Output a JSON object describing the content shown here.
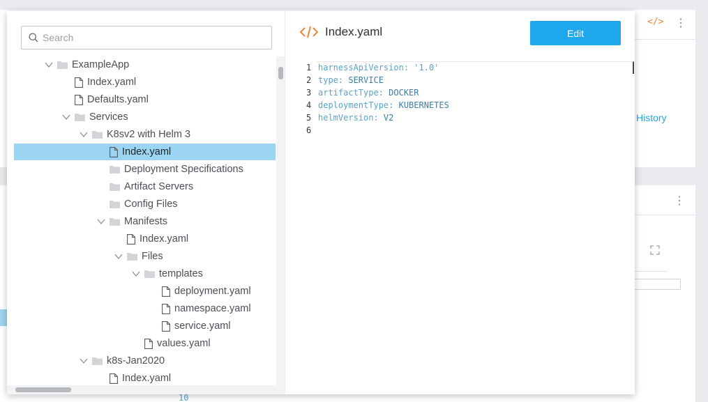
{
  "background": {
    "history_label": "History",
    "code_icon_label": "</>",
    "line_number": "10"
  },
  "search": {
    "placeholder": "Search"
  },
  "tree": [
    {
      "label": "ExampleApp",
      "type": "folder",
      "expanded": true,
      "depth": 0
    },
    {
      "label": "Index.yaml",
      "type": "file",
      "depth": 1
    },
    {
      "label": "Defaults.yaml",
      "type": "file",
      "depth": 1
    },
    {
      "label": "Services",
      "type": "folder",
      "expanded": true,
      "depth": 1
    },
    {
      "label": "K8sv2 with Helm 3",
      "type": "folder",
      "expanded": true,
      "depth": 2
    },
    {
      "label": "Index.yaml",
      "type": "file",
      "depth": 3,
      "selected": true
    },
    {
      "label": "Deployment Specifications",
      "type": "folder",
      "depth": 3
    },
    {
      "label": "Artifact Servers",
      "type": "folder",
      "depth": 3
    },
    {
      "label": "Config Files",
      "type": "folder",
      "depth": 3
    },
    {
      "label": "Manifests",
      "type": "folder",
      "expanded": true,
      "depth": 3
    },
    {
      "label": "Index.yaml",
      "type": "file",
      "depth": 4
    },
    {
      "label": "Files",
      "type": "folder",
      "expanded": true,
      "depth": 4
    },
    {
      "label": "templates",
      "type": "folder",
      "expanded": true,
      "depth": 5
    },
    {
      "label": "deployment.yaml",
      "type": "file",
      "depth": 6
    },
    {
      "label": "namespace.yaml",
      "type": "file",
      "depth": 6
    },
    {
      "label": "service.yaml",
      "type": "file",
      "depth": 6
    },
    {
      "label": "values.yaml",
      "type": "file",
      "depth": 5
    },
    {
      "label": "k8s-Jan2020",
      "type": "folder",
      "expanded": true,
      "depth": 2
    },
    {
      "label": "Index.yaml",
      "type": "file",
      "depth": 3
    }
  ],
  "file_header": {
    "icon": "code-icon",
    "title": "Index.yaml",
    "edit_label": "Edit"
  },
  "editor": {
    "lines": [
      {
        "num": "1",
        "key": "harnessApiVersion",
        "sep": ": ",
        "value": "'1.0'"
      },
      {
        "num": "2",
        "key": "type",
        "sep": ": ",
        "value": "SERVICE"
      },
      {
        "num": "3",
        "key": "artifactType",
        "sep": ": ",
        "value": "DOCKER"
      },
      {
        "num": "4",
        "key": "deploymentType",
        "sep": ": ",
        "value": "KUBERNETES"
      },
      {
        "num": "5",
        "key": "helmVersion",
        "sep": ": ",
        "value": "V2"
      },
      {
        "num": "6",
        "key": "",
        "sep": "",
        "value": ""
      }
    ]
  },
  "colors": {
    "accent": "#1ea7ed",
    "selected_row": "#9bd5f3",
    "code_icon": "#f0833a"
  }
}
